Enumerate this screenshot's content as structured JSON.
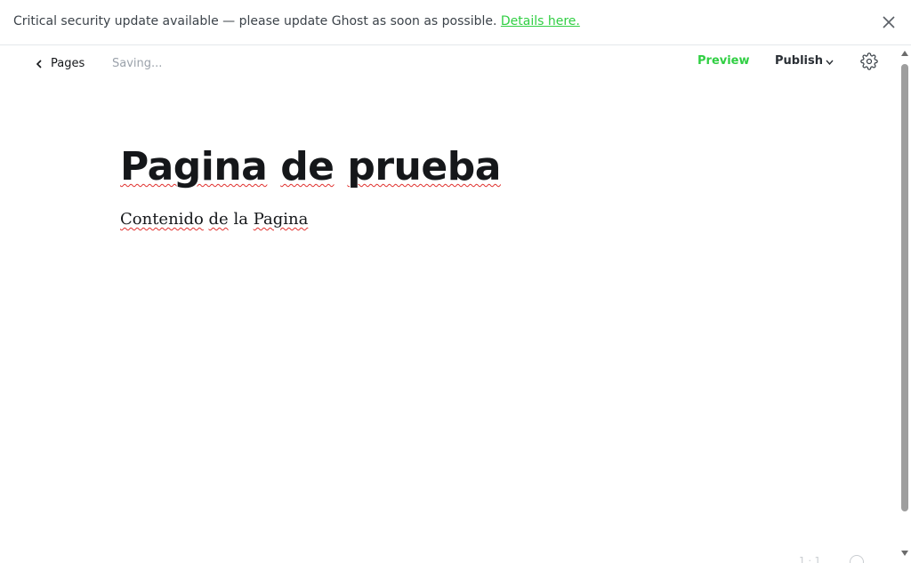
{
  "alert": {
    "message": "Critical security update available — please update Ghost as soon as possible. ",
    "link_label": "Details here.",
    "close_icon": "close-icon"
  },
  "header": {
    "back_label": "Pages",
    "status": "Saving...",
    "preview_label": "Preview",
    "publish_label": "Publish",
    "settings_icon": "gear-icon"
  },
  "editor": {
    "title_words": [
      "Pagina",
      "de",
      "prueba"
    ],
    "body_words": [
      "Contenido",
      "de",
      "la",
      "Pagina"
    ]
  },
  "footer": {
    "word_count_fragment": "1 · 1"
  },
  "colors": {
    "accent": "#30cf43",
    "text": "#15171a",
    "muted": "#9ba2ab",
    "spellcheck": "#e0302d"
  }
}
